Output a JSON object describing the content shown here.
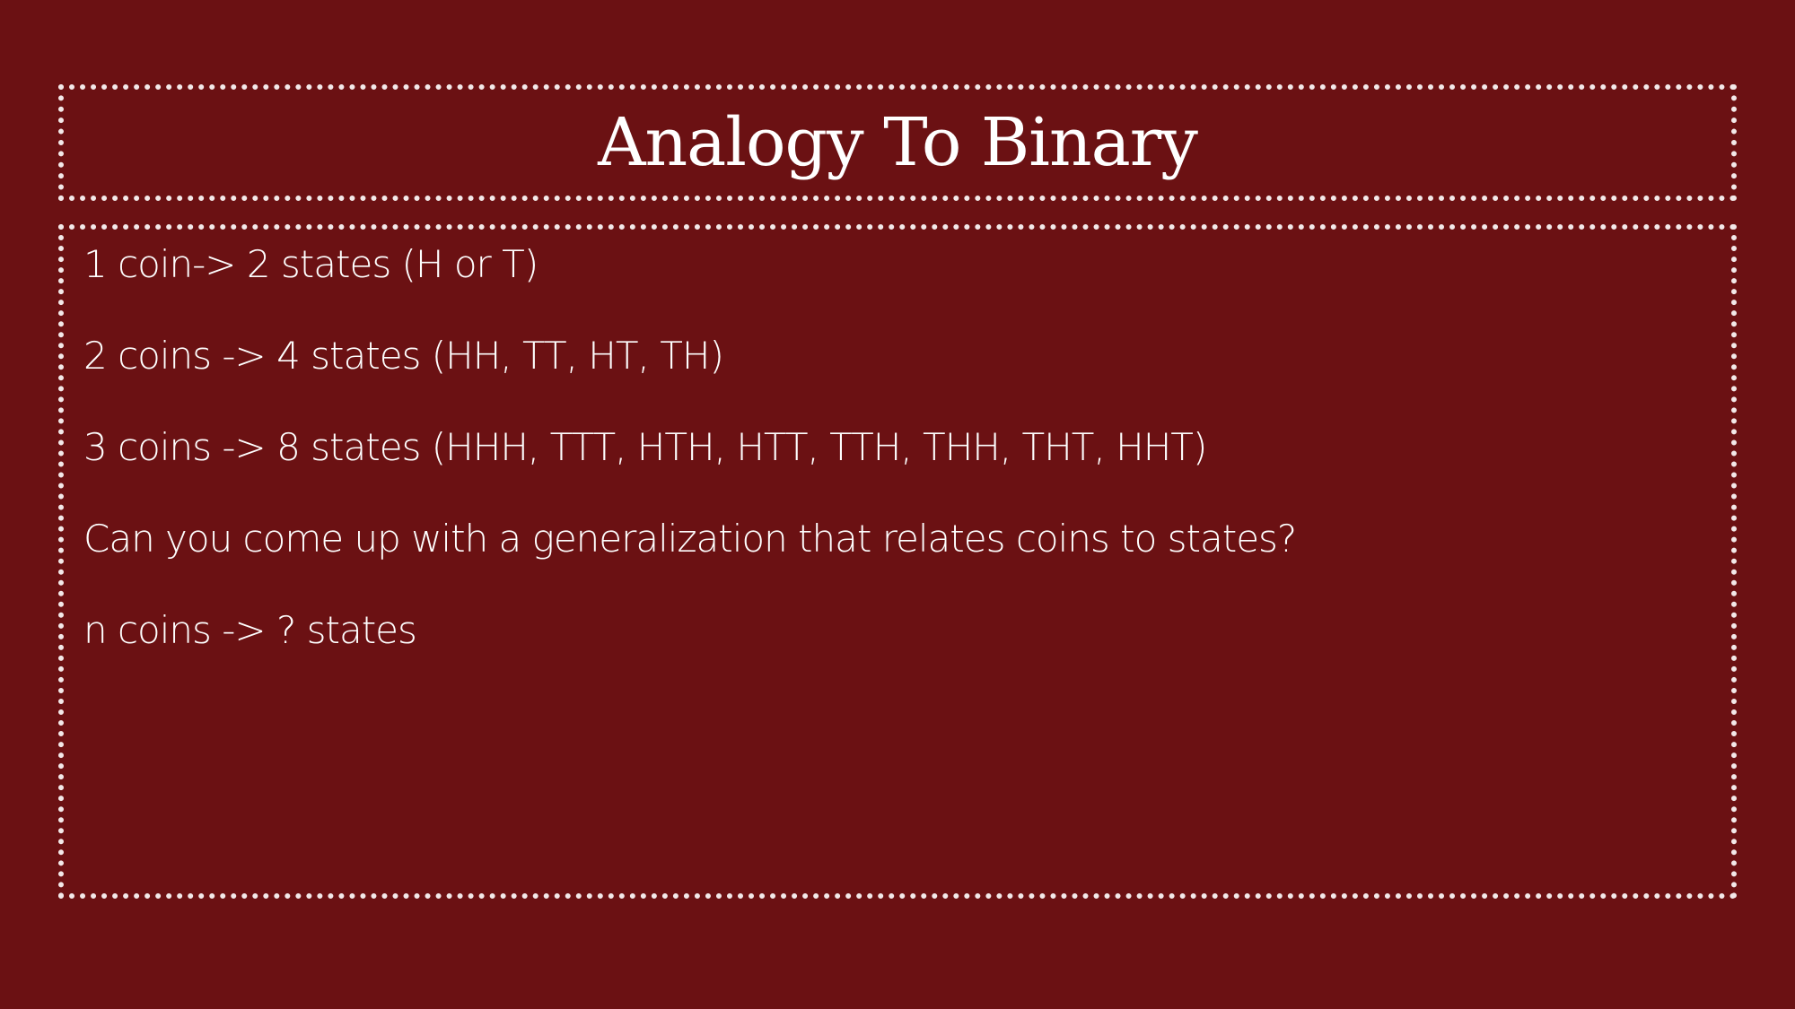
{
  "slide": {
    "title": "Analogy To Binary",
    "lines": [
      "1 coin-> 2 states (H or T)",
      "2 coins -> 4 states (HH, TT, HT, TH)",
      "3 coins -> 8 states (HHH, TTT, HTH, HTT, TTH, THH, THT, HHT)",
      "Can you come up with a generalization that relates coins to states?",
      "n coins -> ? states"
    ]
  },
  "colors": {
    "background": "#6b1113",
    "text": "#ffffff",
    "border": "#f3e9e9"
  }
}
